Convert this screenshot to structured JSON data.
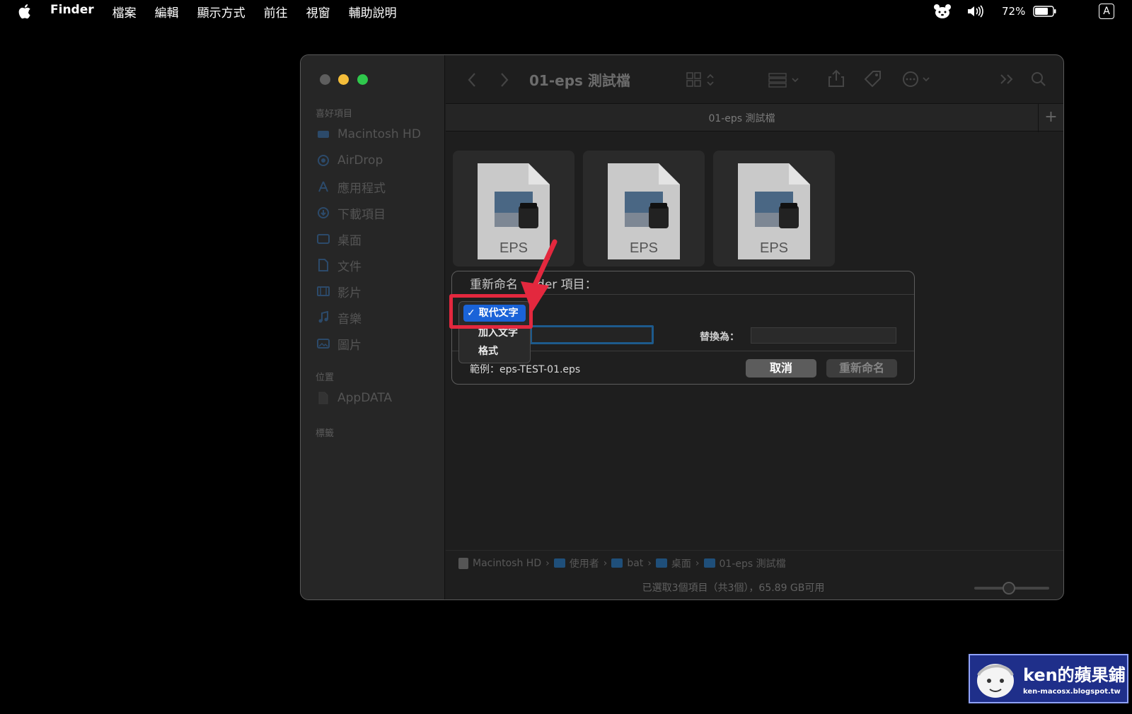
{
  "menubar": {
    "app": "Finder",
    "items": [
      "檔案",
      "編輯",
      "顯示方式",
      "前往",
      "視窗",
      "輔助說明"
    ],
    "battery": "72%",
    "input_source": "A"
  },
  "window": {
    "title": "01-eps 測試檔",
    "tab_label": "01-eps 測試檔"
  },
  "sidebar": {
    "favorites_title": "喜好項目",
    "favorites": [
      {
        "label": "Macintosh HD",
        "icon": "disk-icon"
      },
      {
        "label": "AirDrop",
        "icon": "airdrop-icon"
      },
      {
        "label": "應用程式",
        "icon": "apps-icon"
      },
      {
        "label": "下載項目",
        "icon": "download-icon"
      },
      {
        "label": "桌面",
        "icon": "desktop-icon"
      },
      {
        "label": "文件",
        "icon": "document-icon"
      },
      {
        "label": "影片",
        "icon": "movie-icon"
      },
      {
        "label": "音樂",
        "icon": "music-icon"
      },
      {
        "label": "圖片",
        "icon": "picture-icon"
      }
    ],
    "locations_title": "位置",
    "locations": [
      {
        "label": "AppDATA",
        "icon": "file-icon"
      }
    ],
    "tags_title": "標籤"
  },
  "files": [
    {
      "type_label": "EPS"
    },
    {
      "type_label": "EPS"
    },
    {
      "type_label": "EPS"
    }
  ],
  "pathbar": [
    "Macintosh HD",
    "使用者",
    "bat",
    "桌面",
    "01-eps 測試檔"
  ],
  "statusbar": "已選取3個項目（共3個），65.89 GB可用",
  "dialog": {
    "title_left": "重新命名",
    "title_right": "der 項目：",
    "replace_label": "替換為：",
    "example": "範例：eps-TEST-01.eps",
    "cancel": "取消",
    "rename": "重新命名"
  },
  "popup": {
    "selected": "✓ 取代文字",
    "options": [
      "加入文字",
      "格式"
    ]
  },
  "brand": {
    "name": "ken的蘋果鋪",
    "url": "ken-macosx.blogspot.tw"
  },
  "colors": {
    "accent": "#1a63d8",
    "highlight": "#e3283e"
  }
}
